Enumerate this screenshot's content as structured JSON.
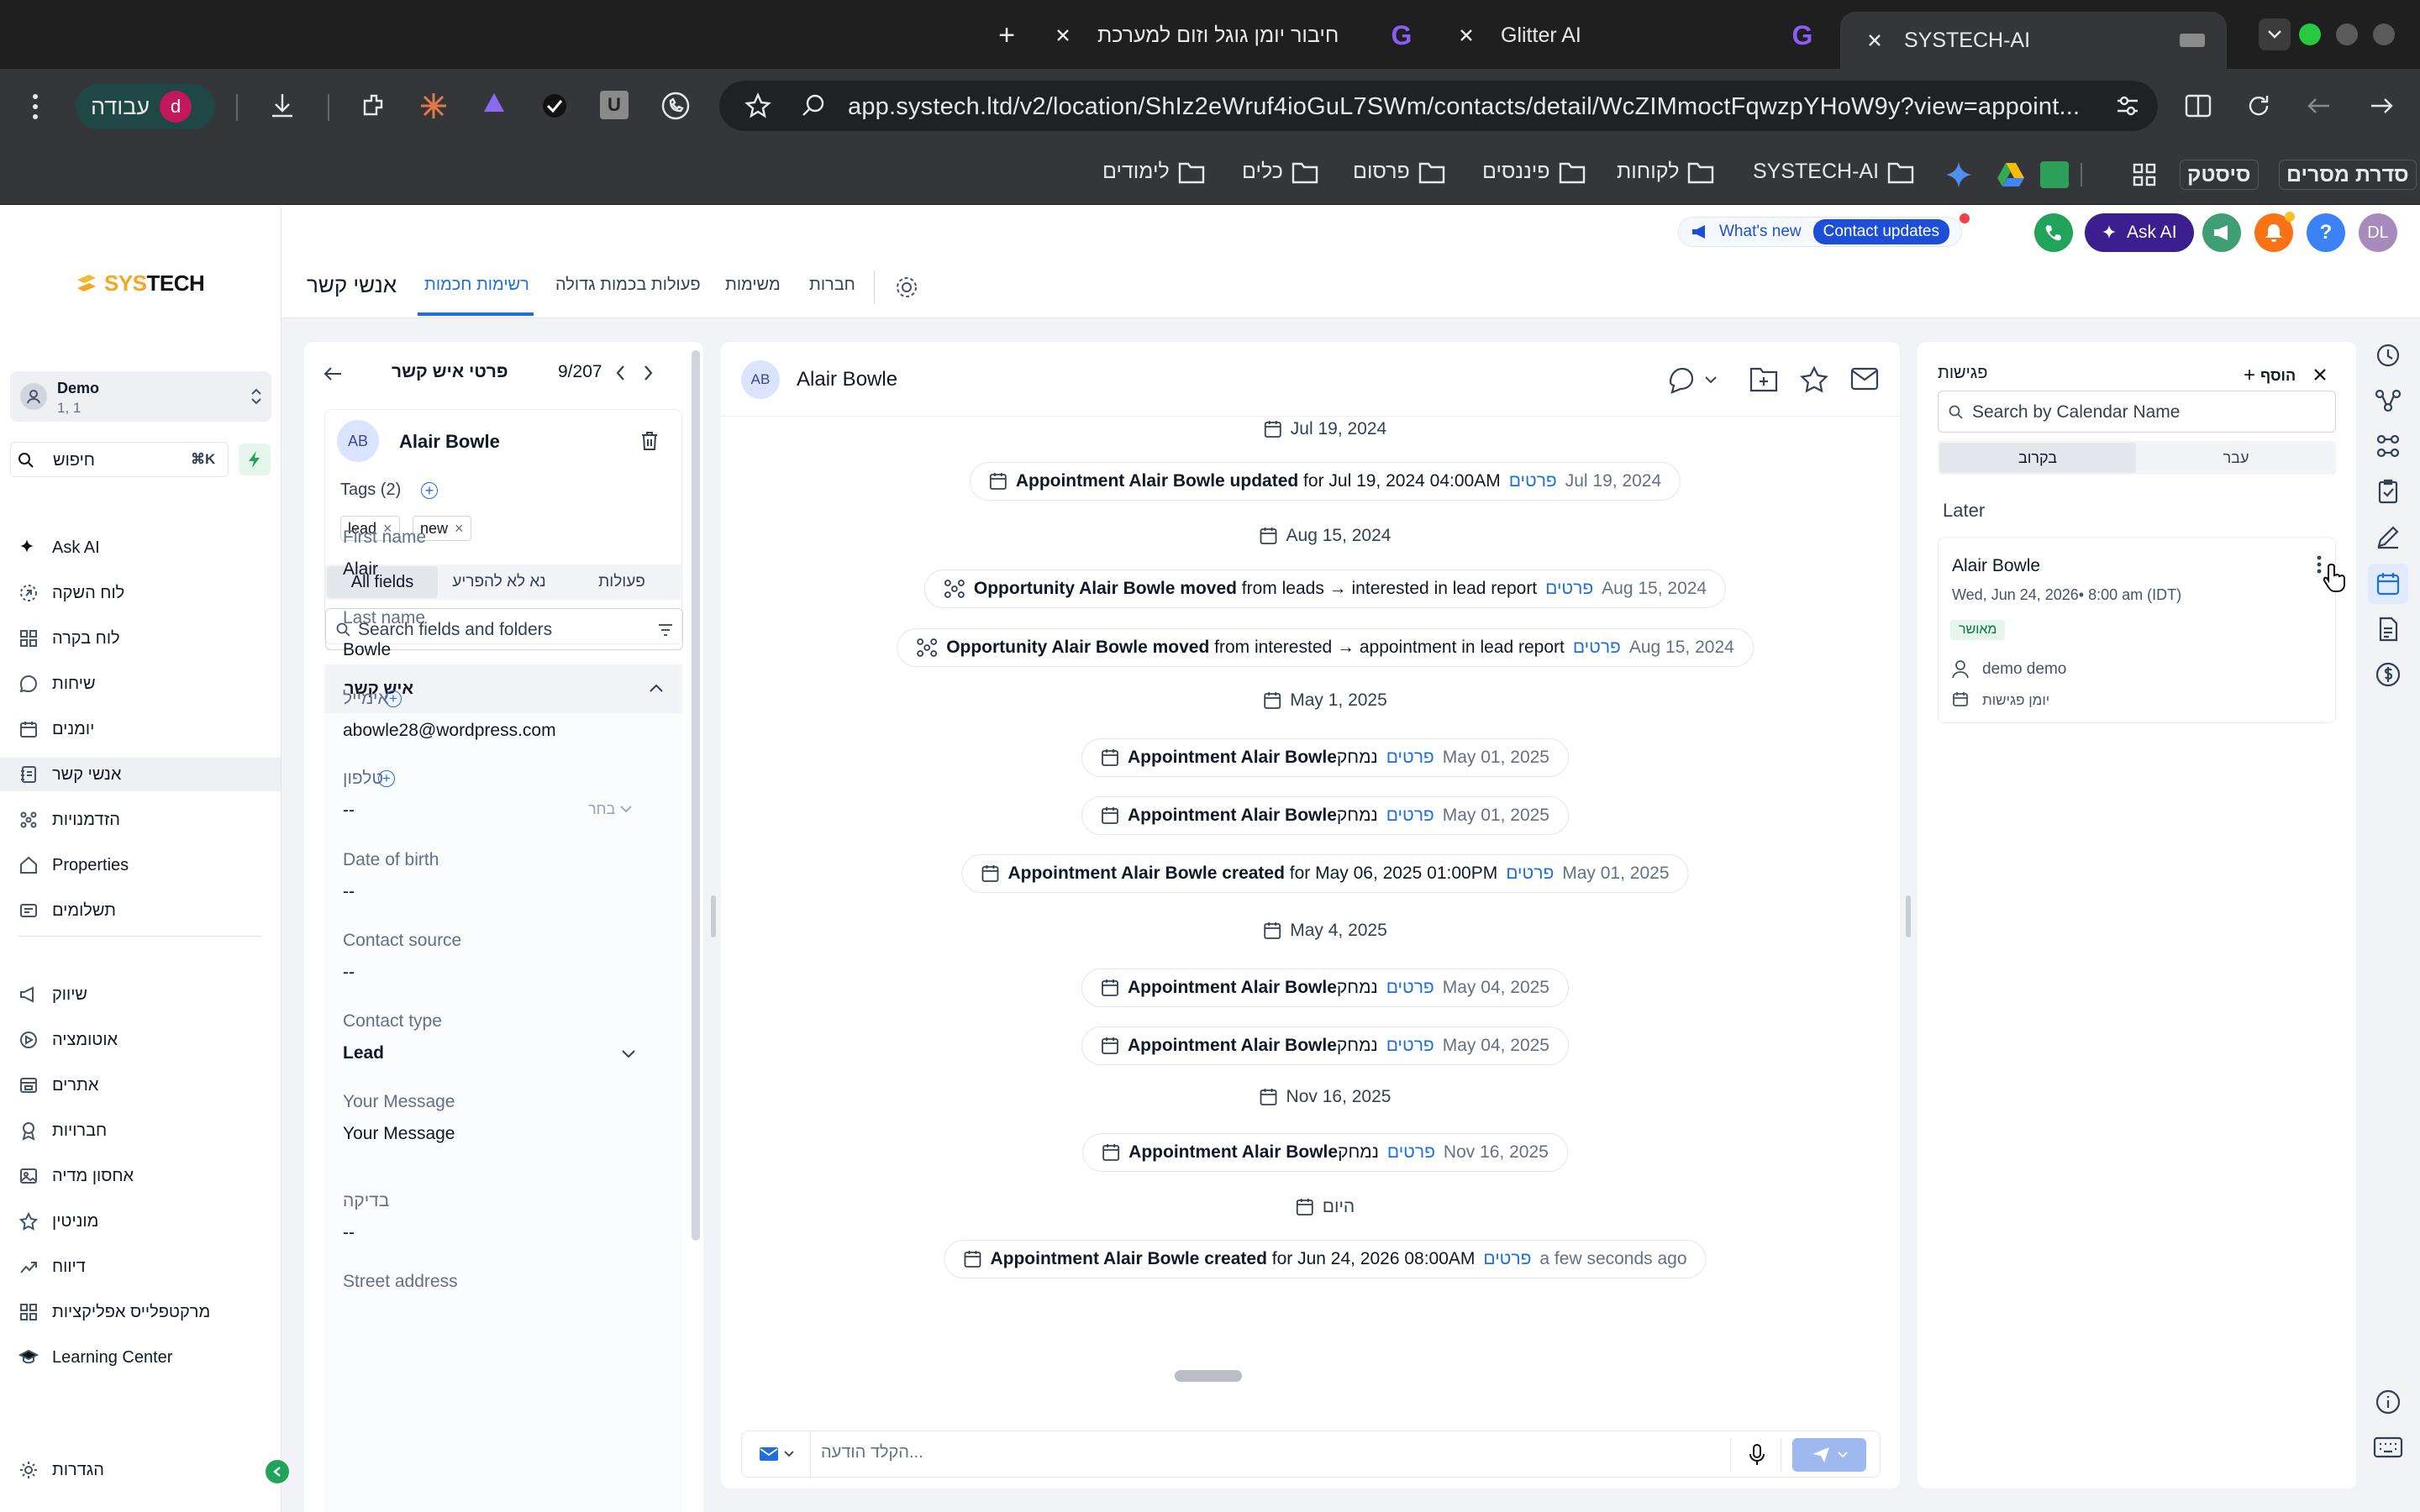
{
  "browser": {
    "tabs": [
      {
        "label": "SYSTECH-AI"
      },
      {
        "label": "Glitter AI"
      },
      {
        "label": "חיבור יומן גוגל וזום למערכת"
      }
    ],
    "new_tab_label": "+",
    "url": "app.systech.ltd/v2/location/ShIz2eWruf4ioGuL7SWm/contacts/detail/WcZIMmoctFqwzpYHoW9y?view=appoint...",
    "profile_label": "עבודה",
    "profile_initial": "d",
    "bookmarks": [
      "סדרת מסרים",
      "סיסטק",
      "SYSTECH-AI",
      "לקוחות",
      "פיננסים",
      "פרסום",
      "כלים",
      "לימודים"
    ]
  },
  "app": {
    "logo": "SYSTECH",
    "account": {
      "name": "Demo",
      "sub": "1, 1"
    },
    "search": {
      "label": "חיפוש",
      "shortcut": "⌘K"
    },
    "nav": [
      {
        "label": "Ask AI",
        "icon": "sparkle-icon"
      },
      {
        "label": "לוח השקה",
        "icon": "launch-icon"
      },
      {
        "label": "לוח בקרה",
        "icon": "dashboard-icon"
      },
      {
        "label": "שיחות",
        "icon": "chat-icon"
      },
      {
        "label": "יומנים",
        "icon": "calendar-icon"
      },
      {
        "label": "אנשי קשר",
        "icon": "contacts-icon"
      },
      {
        "label": "הזדמנויות",
        "icon": "opportunities-icon"
      },
      {
        "label": "Properties",
        "icon": "home-icon"
      },
      {
        "label": "תשלומים",
        "icon": "payments-icon"
      },
      {
        "label": "שיווק",
        "icon": "marketing-icon"
      },
      {
        "label": "אוטומציה",
        "icon": "automation-icon"
      },
      {
        "label": "אתרים",
        "icon": "sites-icon"
      },
      {
        "label": "חברויות",
        "icon": "membership-icon"
      },
      {
        "label": "אחסון מדיה",
        "icon": "media-icon"
      },
      {
        "label": "מוניטין",
        "icon": "star-icon"
      },
      {
        "label": "דיווח",
        "icon": "report-icon"
      },
      {
        "label": "מרקטפלייס אפליקציות",
        "icon": "apps-icon"
      },
      {
        "label": "Learning Center",
        "icon": "learning-icon"
      }
    ],
    "settings_label": "הגדרות",
    "page_title": "אנשי קשר",
    "top_tabs": [
      "רשימות חכמות",
      "פעולות בכמות גדולה",
      "משימות",
      "חברות"
    ],
    "whats_new": "What's new",
    "contact_updates": "Contact updates",
    "ask_ai": "Ask AI",
    "user_initials": "DL"
  },
  "contact_panel": {
    "header": "פרטי איש קשר",
    "pager": "9/207",
    "initials": "AB",
    "name": "Alair Bowle",
    "tags_label": "Tags (2)",
    "tags": [
      "lead",
      "new"
    ],
    "tabs": [
      "All fields",
      "נא לא להפריע",
      "פעולות"
    ],
    "search_placeholder": "Search fields and folders",
    "section": "איש קשר",
    "fields": [
      {
        "label": "First name",
        "value": "Alair"
      },
      {
        "label": "Last name",
        "value": "Bowle"
      },
      {
        "label": "אימייל",
        "value": "abowle28@wordpress.com"
      },
      {
        "label": "טלפון",
        "value": "--",
        "hint": "בחר"
      },
      {
        "label": "Date of birth",
        "value": "--"
      },
      {
        "label": "Contact source",
        "value": "--"
      },
      {
        "label": "Contact type",
        "value": "Lead"
      },
      {
        "label": "Your Message",
        "value": "Your Message"
      },
      {
        "label": "בדיקה",
        "value": "--"
      },
      {
        "label": "Street address",
        "value": ""
      }
    ]
  },
  "timeline": {
    "contact_initials": "AB",
    "contact_name": "Alair Bowle",
    "details_link": "פרטים",
    "items": [
      {
        "type": "date",
        "text": "Jul 19, 2024",
        "icon": "calendar-icon"
      },
      {
        "type": "event",
        "icon": "calendar-icon",
        "bold": "Appointment Alair Bowle updated",
        "rest": " for Jul 19, 2024 04:00AM",
        "date": "Jul 19, 2024"
      },
      {
        "type": "date",
        "text": "Aug 15, 2024",
        "icon": "calendar-icon"
      },
      {
        "type": "event",
        "icon": "pipeline-icon",
        "bold": "Opportunity Alair Bowle moved",
        "rest": " from leads → interested in lead report",
        "date": "Aug 15, 2024"
      },
      {
        "type": "event",
        "icon": "pipeline-icon",
        "bold": "Opportunity Alair Bowle moved",
        "rest": " from interested → appointment in lead report",
        "date": "Aug 15, 2024"
      },
      {
        "type": "date",
        "text": "May 1, 2025",
        "icon": "calendar-icon"
      },
      {
        "type": "event",
        "icon": "calendar-icon",
        "bold": "Appointment Alair Bowle",
        "rest": "נמחק",
        "date": "May 01, 2025"
      },
      {
        "type": "event",
        "icon": "calendar-icon",
        "bold": "Appointment Alair Bowle",
        "rest": "נמחק",
        "date": "May 01, 2025"
      },
      {
        "type": "event",
        "icon": "calendar-icon",
        "bold": "Appointment Alair Bowle created",
        "rest": " for May 06, 2025 01:00PM",
        "date": "May 01, 2025"
      },
      {
        "type": "date",
        "text": "May 4, 2025",
        "icon": "calendar-icon"
      },
      {
        "type": "event",
        "icon": "calendar-icon",
        "bold": "Appointment Alair Bowle",
        "rest": "נמחק",
        "date": "May 04, 2025"
      },
      {
        "type": "event",
        "icon": "calendar-icon",
        "bold": "Appointment Alair Bowle",
        "rest": "נמחק",
        "date": "May 04, 2025"
      },
      {
        "type": "date",
        "text": "Nov 16, 2025",
        "icon": "calendar-icon"
      },
      {
        "type": "event",
        "icon": "calendar-icon",
        "bold": "Appointment Alair Bowle",
        "rest": "נמחק",
        "date": "Nov 16, 2025"
      },
      {
        "type": "date",
        "text": "היום",
        "icon": "calendar-icon"
      },
      {
        "type": "event",
        "icon": "calendar-icon",
        "bold": "Appointment Alair Bowle created",
        "rest": " for Jun 24, 2026 08:00AM",
        "date": "a few seconds ago"
      }
    ],
    "composer_placeholder": "הקלד הודעה..."
  },
  "meetings": {
    "title": "פגישות",
    "add_label": "הוסף",
    "search_placeholder": "Search by Calendar Name",
    "tabs": [
      "בקרוב",
      "עבר"
    ],
    "section": "Later",
    "card": {
      "name": "Alair Bowle",
      "when": "Wed, Jun 24, 2026• 8:00 am (IDT)",
      "status": "מאושר",
      "owner": "demo demo",
      "calendar": "יומן פגישות"
    }
  }
}
